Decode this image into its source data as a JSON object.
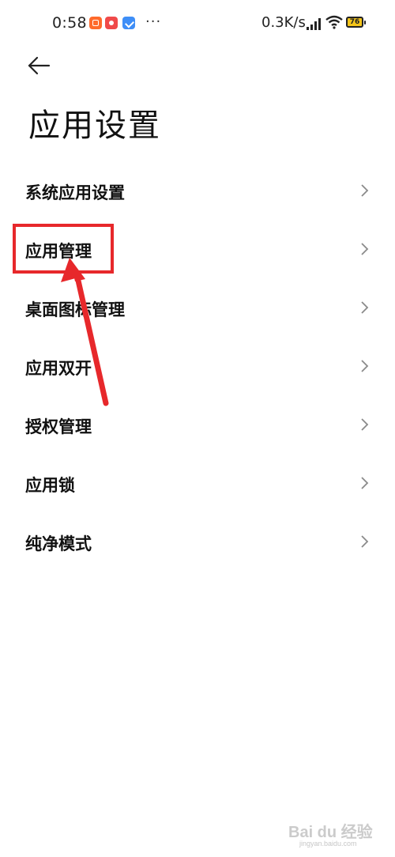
{
  "status_bar": {
    "time": "0:58",
    "more": "···",
    "net_speed": "0.3K/s",
    "battery": "76",
    "notification_icons": [
      "taobao-app-icon",
      "record-app-icon",
      "store-app-icon"
    ]
  },
  "header": {
    "back_icon": "arrow-left-icon",
    "title": "应用设置"
  },
  "menu": {
    "items": [
      {
        "label": "系统应用设置"
      },
      {
        "label": "应用管理"
      },
      {
        "label": "桌面图标管理"
      },
      {
        "label": "应用双开"
      },
      {
        "label": "授权管理"
      },
      {
        "label": "应用锁"
      },
      {
        "label": "纯净模式"
      }
    ]
  },
  "watermark": {
    "text": "Bai du 经验",
    "sub": "jingyan.baidu.com"
  },
  "colors": {
    "annotation": "#e7282b",
    "battery": "#f4c51a"
  }
}
